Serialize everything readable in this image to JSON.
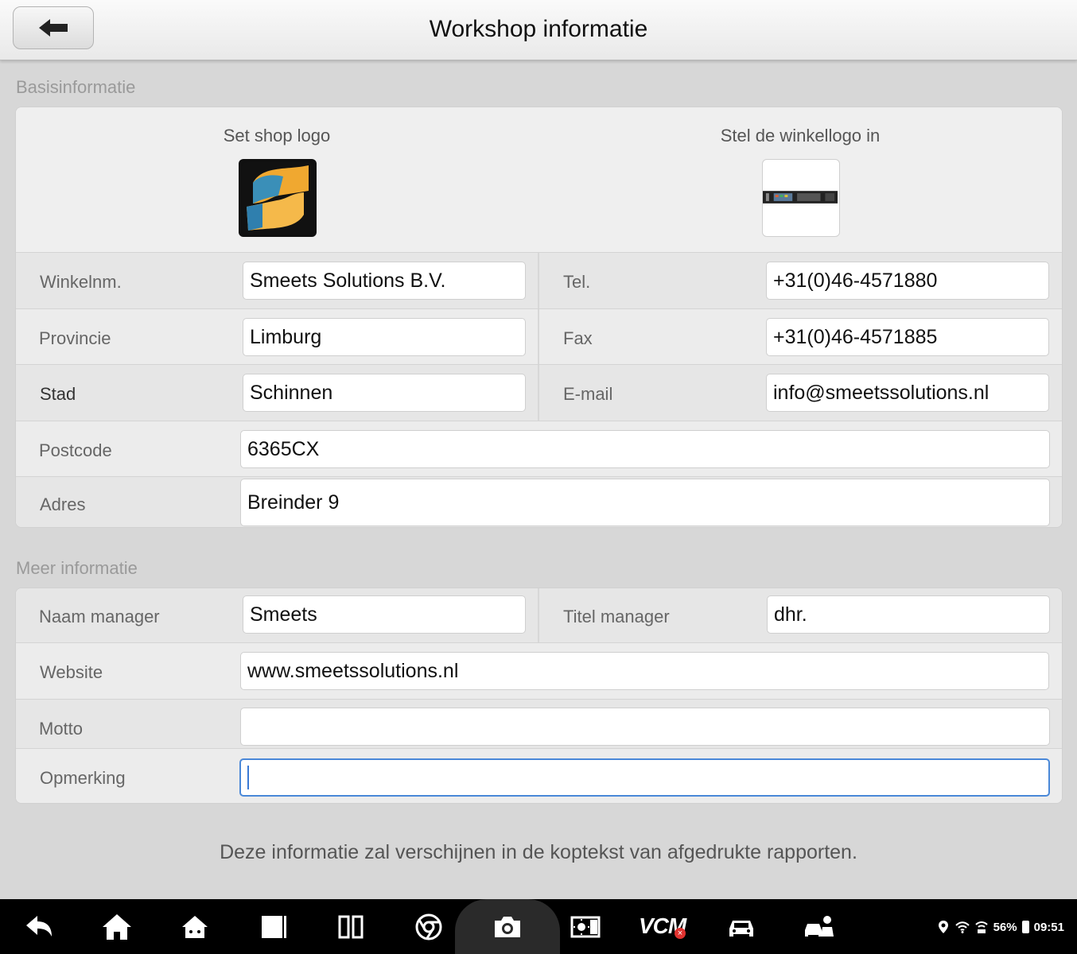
{
  "header": {
    "title": "Workshop informatie",
    "back_icon": "back-arrow-icon"
  },
  "sections": {
    "basis": "Basisinformatie",
    "meer": "Meer informatie"
  },
  "logos": {
    "shop_label": "Set shop logo",
    "winkel_label": "Stel de winkellogo in"
  },
  "basis": {
    "winkelnm_label": "Winkelnm.",
    "winkelnm_value": "Smeets Solutions B.V.",
    "tel_label": "Tel.",
    "tel_value": "+31(0)46-4571880",
    "provincie_label": "Provincie",
    "provincie_value": "Limburg",
    "fax_label": "Fax",
    "fax_value": "+31(0)46-4571885",
    "stad_label": "Stad",
    "stad_value": "Schinnen",
    "email_label": "E-mail",
    "email_value": "info@smeetssolutions.nl",
    "postcode_label": "Postcode",
    "postcode_value": "6365CX",
    "adres_label": "Adres",
    "adres_value": "Breinder 9"
  },
  "meer": {
    "naam_label": "Naam manager",
    "naam_value": "Smeets",
    "titel_label": "Titel manager",
    "titel_value": "dhr.",
    "website_label": "Website",
    "website_value": "www.smeetssolutions.nl",
    "motto_label": "Motto",
    "motto_value": "",
    "opmerking_label": "Opmerking",
    "opmerking_value": ""
  },
  "footer_note": "Deze informatie zal verschijnen in de koptekst van afgedrukte rapporten.",
  "navbar": {
    "vcm": "VCM",
    "battery": "56%",
    "time": "09:51"
  }
}
